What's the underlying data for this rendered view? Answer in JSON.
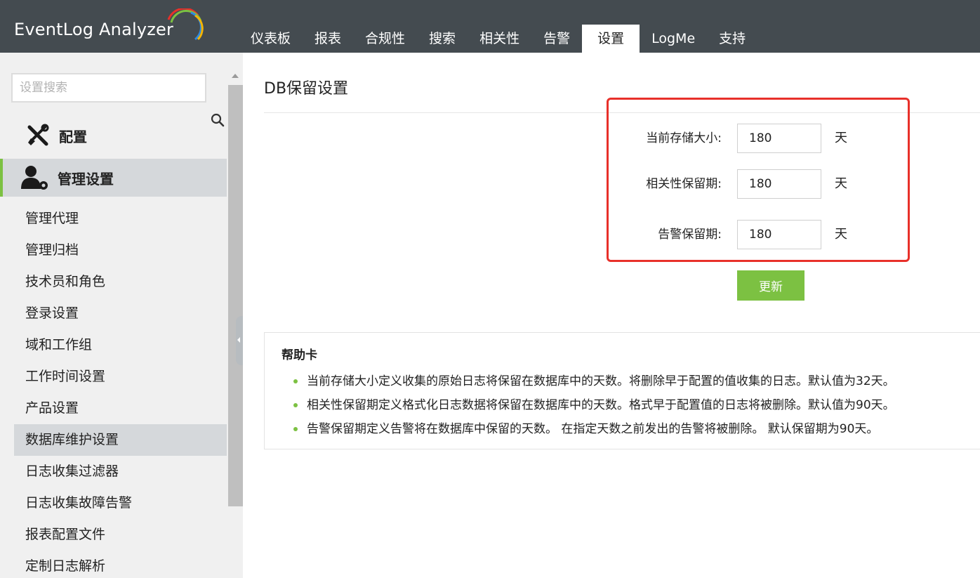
{
  "app": {
    "logo_text": "EventLog Analyzer"
  },
  "nav": {
    "tabs": [
      {
        "label": "仪表板"
      },
      {
        "label": "报表"
      },
      {
        "label": "合规性"
      },
      {
        "label": "搜索"
      },
      {
        "label": "相关性"
      },
      {
        "label": "告警"
      },
      {
        "label": "设置",
        "active": true
      },
      {
        "label": "LogMe"
      },
      {
        "label": "支持"
      }
    ]
  },
  "sidebar": {
    "search_placeholder": "设置搜索",
    "section_config": "配置",
    "section_admin": "管理设置",
    "items": [
      {
        "label": "管理代理"
      },
      {
        "label": "管理归档"
      },
      {
        "label": "技术员和角色"
      },
      {
        "label": "登录设置"
      },
      {
        "label": "域和工作组"
      },
      {
        "label": "工作时间设置"
      },
      {
        "label": "产品设置"
      },
      {
        "label": "数据库维护设置",
        "active": true
      },
      {
        "label": "日志收集过滤器"
      },
      {
        "label": "日志收集故障告警"
      },
      {
        "label": "报表配置文件"
      },
      {
        "label": "定制日志解析"
      }
    ]
  },
  "main": {
    "title": "DB保留设置",
    "fields": [
      {
        "label": "当前存储大小:",
        "value": "180",
        "unit": "天"
      },
      {
        "label": "相关性保留期:",
        "value": "180",
        "unit": "天"
      },
      {
        "label": "告警保留期:",
        "value": "180",
        "unit": "天"
      }
    ],
    "update_label": "更新"
  },
  "help": {
    "title": "帮助卡",
    "items": [
      "当前存储大小定义收集的原始日志将保留在数据库中的天数。将删除早于配置的值收集的日志。默认值为32天。",
      "相关性保留期定义格式化日志数据将保留在数据库中的天数。格式早于配置值的日志将被删除。默认值为90天。",
      "告警保留期定义告警将在数据库中保留的天数。 在指定天数之前发出的告警将被删除。 默认保留期为90天。"
    ]
  },
  "colors": {
    "header_bg": "#444b50",
    "accent_green": "#7cc142",
    "highlight_red": "#e8302a",
    "sidebar_bg": "#f0f0f0",
    "active_item_bg": "#d5d8db"
  }
}
